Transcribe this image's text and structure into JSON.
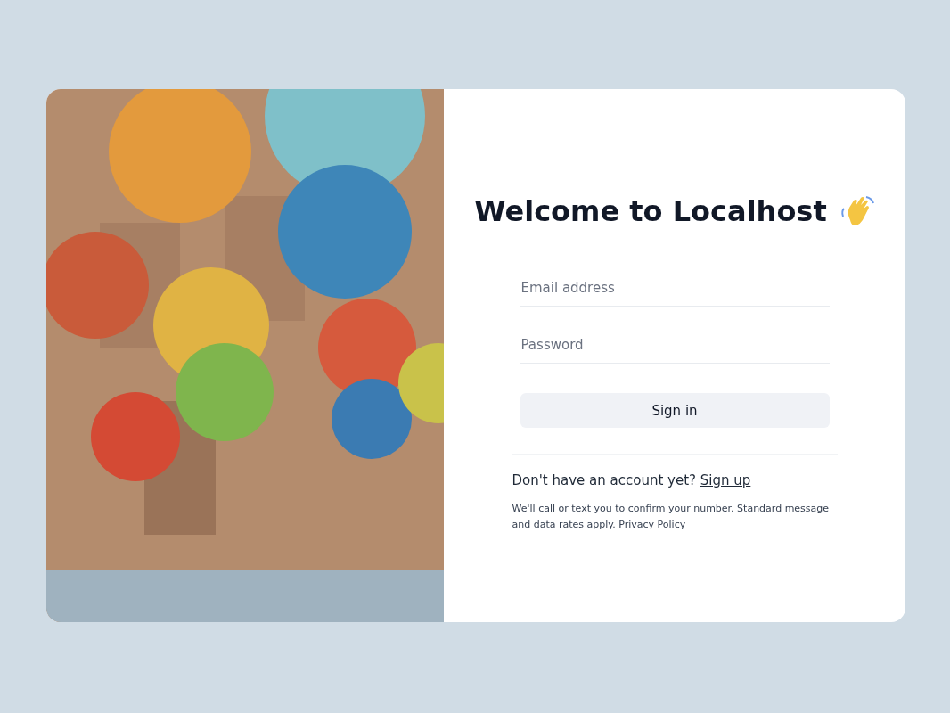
{
  "title": "Welcome to Localhost",
  "fields": [
    {
      "placeholder": "Email address"
    },
    {
      "placeholder": "Password"
    }
  ],
  "submit": "Sign in",
  "signup": {
    "text": "Don't have an account yet?",
    "link": "Sign up"
  },
  "note": {
    "text": "We'll call or text you to confirm your number. Standard message and data rates apply.",
    "link": "Privacy Policy"
  }
}
